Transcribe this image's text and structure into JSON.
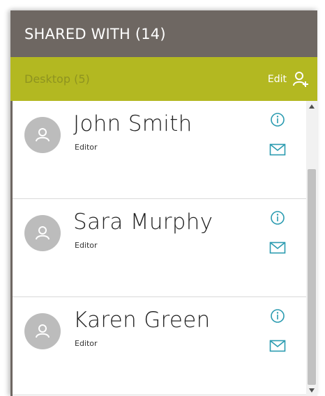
{
  "header": {
    "title": "SHARED WITH (14)"
  },
  "group": {
    "title": "Desktop (5)",
    "edit_label": "Edit",
    "add_icon": "add-user-icon"
  },
  "people": [
    {
      "name": "John Smith",
      "role": "Editor"
    },
    {
      "name": "Sara Murphy",
      "role": "Editor"
    },
    {
      "name": "Karen Green",
      "role": "Editor"
    }
  ],
  "colors": {
    "header_bg": "#6e6762",
    "group_bg": "#b3b821",
    "accent": "#2a9bb0",
    "avatar": "#bcbcbc"
  },
  "scrollbar": {
    "position_fraction": 0.2
  }
}
